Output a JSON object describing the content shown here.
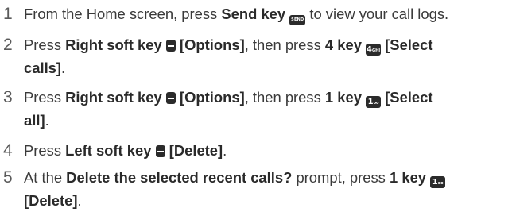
{
  "steps": [
    {
      "number": "1",
      "parts": [
        "From the Home screen, press ",
        "Send key",
        " to view your call logs."
      ],
      "send_key_icon": "SEND"
    },
    {
      "number": "2",
      "line1": [
        "Press ",
        "Right soft key",
        " ",
        "[Options]",
        ", then press ",
        "4 key",
        " ",
        "[Select"
      ],
      "line2": [
        "calls]",
        "."
      ],
      "key4_icon": "4",
      "key4_sub": "GHI"
    },
    {
      "number": "3",
      "line1": [
        "Press ",
        "Right soft key",
        " ",
        "[Options]",
        ", then press ",
        "1 key",
        " ",
        "[Select"
      ],
      "line2": [
        "all]",
        "."
      ],
      "key1_icon": "1",
      "key1_sub": "oo"
    },
    {
      "number": "4",
      "parts": [
        "Press ",
        "Left soft key",
        " ",
        "[Delete]",
        "."
      ]
    },
    {
      "number": "5",
      "line1": [
        "At the ",
        "Delete the selected recent calls?",
        " prompt, press ",
        "1 key",
        " "
      ],
      "line2": [
        "[Delete]",
        "."
      ],
      "key1_icon": "1",
      "key1_sub": "oo"
    }
  ]
}
